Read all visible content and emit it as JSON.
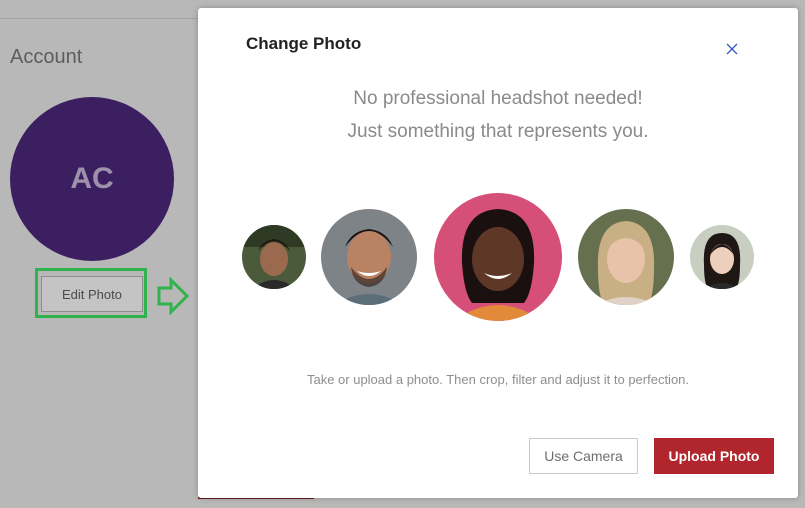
{
  "account": {
    "title": "Account",
    "avatar_initials": "AC",
    "edit_photo_label": "Edit Photo"
  },
  "modal": {
    "title": "Change Photo",
    "close_icon": "close-icon",
    "tagline_line1": "No professional headshot needed!",
    "tagline_line2": "Just something that represents you.",
    "hint": "Take or upload a photo. Then crop, filter and adjust it to perfection.",
    "use_camera_label": "Use Camera",
    "upload_photo_label": "Upload Photo"
  },
  "colors": {
    "avatar_bg": "#3c1f60",
    "highlight": "#2fb34c",
    "upload_button": "#b1262c"
  }
}
